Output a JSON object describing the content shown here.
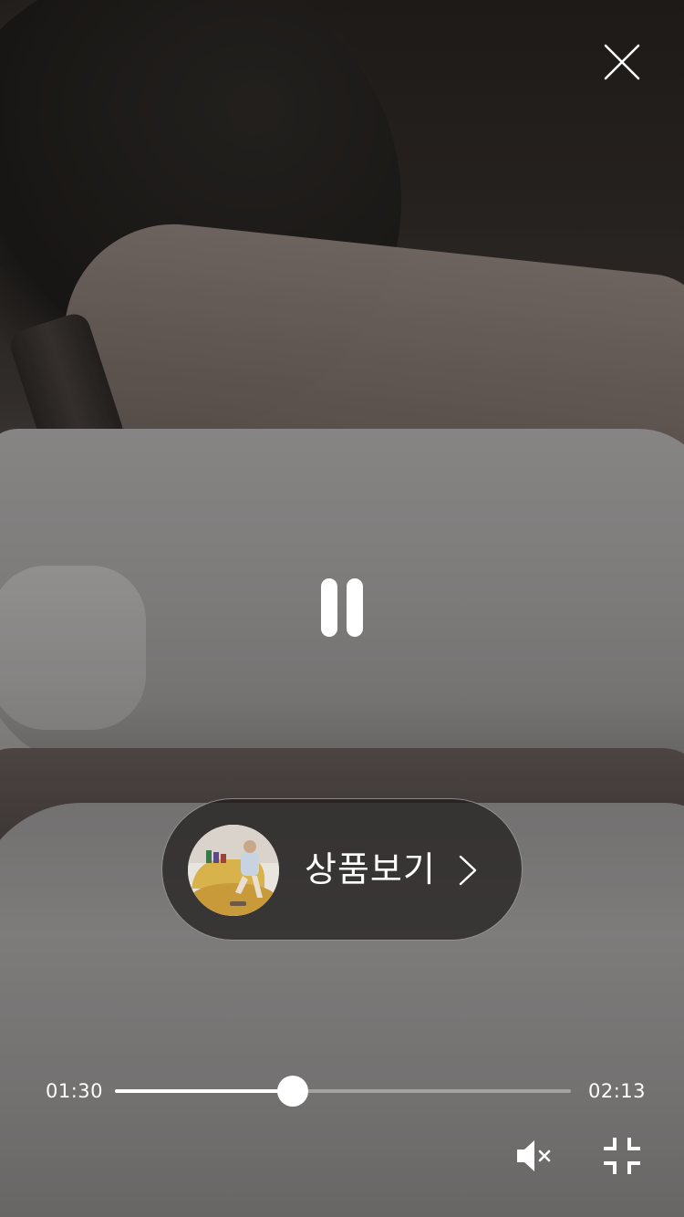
{
  "player": {
    "current_time": "01:30",
    "total_time": "02:13",
    "progress": 0.39,
    "state": "paused-control-visible",
    "muted": true
  },
  "product_button": {
    "label": "상품보기"
  },
  "icons": {
    "close": "close-icon",
    "pause": "pause-icon",
    "chevron": "chevron-right-icon",
    "mute": "volume-mute-icon",
    "collapse": "exit-fullscreen-icon"
  },
  "colors": {
    "controls": "#ffffff",
    "pill_background": "#1e1c1b"
  }
}
